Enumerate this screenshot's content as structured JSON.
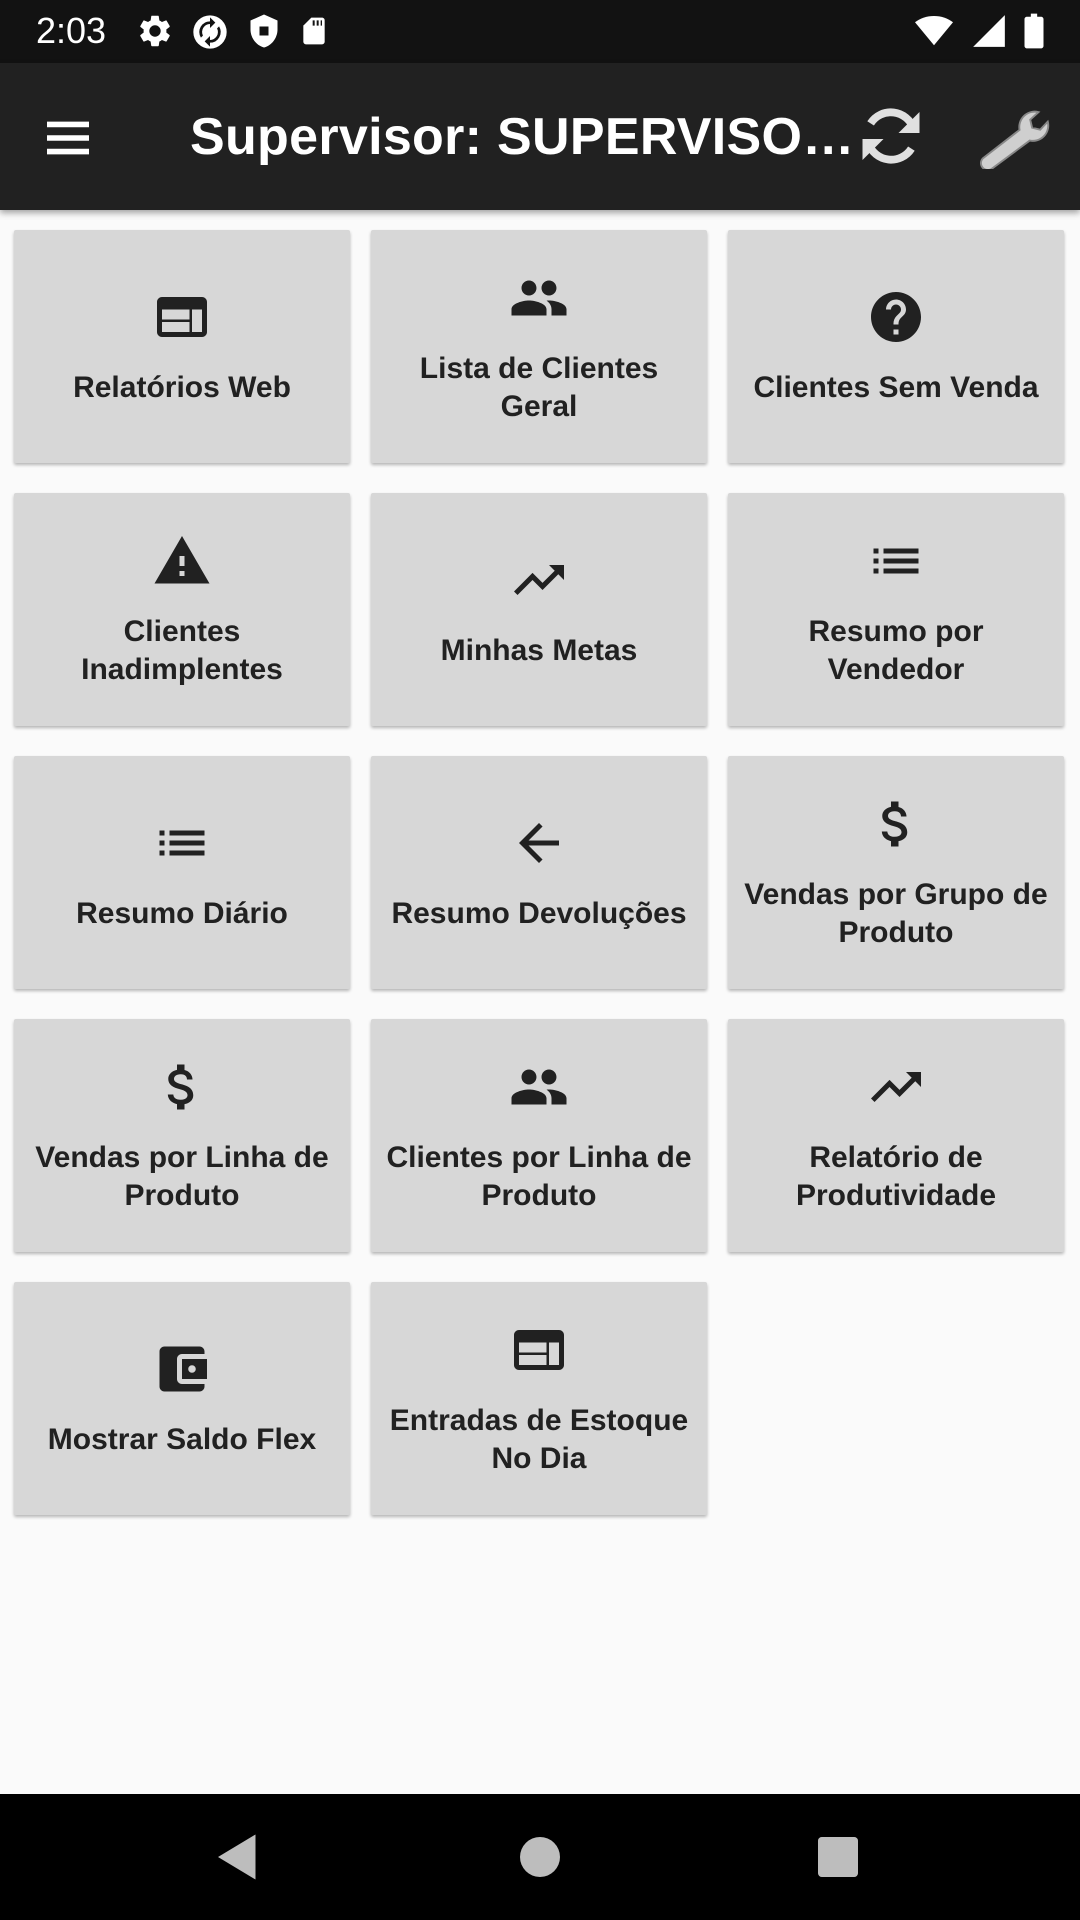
{
  "status_bar": {
    "time": "2:03",
    "left_icons": [
      "settings-icon",
      "sync-status-icon",
      "shield-icon",
      "sd-card-icon"
    ],
    "right_icons": [
      "wifi-icon",
      "signal-icon",
      "battery-icon"
    ]
  },
  "app_bar": {
    "title": "Supervisor: SUPERVISO…",
    "menu_icon": "menu-icon",
    "sync_icon": "sync-icon",
    "settings_icon": "wrench-icon"
  },
  "tiles": [
    {
      "label": "Relatórios Web",
      "icon": "web-icon"
    },
    {
      "label": "Lista de Clientes Geral",
      "icon": "people-icon"
    },
    {
      "label": "Clientes Sem Venda",
      "icon": "help-icon"
    },
    {
      "label": "Clientes Inadimplentes",
      "icon": "warning-icon"
    },
    {
      "label": "Minhas Metas",
      "icon": "trending-up-icon"
    },
    {
      "label": "Resumo por Vendedor",
      "icon": "list-icon"
    },
    {
      "label": "Resumo Diário",
      "icon": "list-icon"
    },
    {
      "label": "Resumo Devoluções",
      "icon": "arrow-back-icon"
    },
    {
      "label": "Vendas por Grupo de Produto",
      "icon": "dollar-icon"
    },
    {
      "label": "Vendas por Linha de Produto",
      "icon": "dollar-icon"
    },
    {
      "label": "Clientes por Linha de Produto",
      "icon": "people-icon"
    },
    {
      "label": "Relatório de Produtividade",
      "icon": "trending-up-icon"
    },
    {
      "label": "Mostrar Saldo Flex",
      "icon": "wallet-icon"
    },
    {
      "label": "Entradas de Estoque No Dia",
      "icon": "web-icon"
    }
  ],
  "nav_bar": {
    "buttons": [
      "back-icon",
      "home-icon",
      "recents-icon"
    ]
  }
}
